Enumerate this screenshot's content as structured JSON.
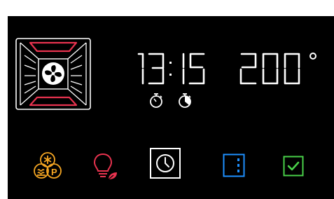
{
  "display": {
    "time_hours": "13",
    "time_minutes": "15",
    "time_separator": ":",
    "temperature": "200",
    "degree_symbol": "°"
  },
  "mode": {
    "icon": "fan-heating-mode-icon",
    "heater_color": "#e8334f"
  },
  "timers": [
    {
      "icon": "timer-start-icon"
    },
    {
      "icon": "timer-end-icon"
    }
  ],
  "controls": [
    {
      "name": "function-selector-button",
      "icon": "fan-defrost-programs-icon",
      "color": "#f5a623"
    },
    {
      "name": "light-eco-button",
      "icon": "lightbulb-leaf-icon",
      "color": "#e8334f",
      "leaf_color": "#e8334f"
    },
    {
      "name": "clock-button",
      "icon": "clock-icon",
      "color": "#ffffff",
      "selected": true
    },
    {
      "name": "menu-button",
      "icon": "vertical-dots-icon",
      "color": "#1e90ff"
    },
    {
      "name": "confirm-button",
      "icon": "checkmark-icon",
      "color": "#49d049"
    }
  ],
  "colors": {
    "background": "#000000",
    "display_text": "#ffffff",
    "function_orange": "#f5a623",
    "light_red": "#e8334f",
    "menu_blue": "#1e90ff",
    "confirm_green": "#49d049"
  }
}
